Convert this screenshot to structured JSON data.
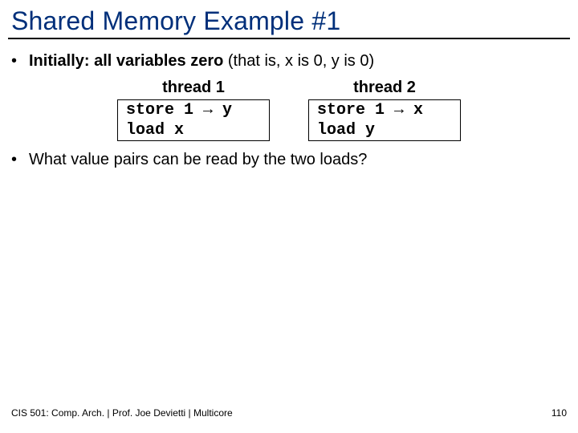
{
  "title": "Shared Memory Example #1",
  "bullets": {
    "b1_bold": "Initially: all variables zero",
    "b1_rest": " (that is, x is 0, y is 0)",
    "b2": "What value pairs can be read by the two loads?"
  },
  "threads": {
    "t1": {
      "title": "thread 1",
      "line1": "store 1 → y",
      "line2": "load x"
    },
    "t2": {
      "title": "thread 2",
      "line1": "store 1 → x",
      "line2": "load y"
    }
  },
  "footer": {
    "left": "CIS 501: Comp. Arch.  |  Prof. Joe Devietti  |  Multicore",
    "right": "110"
  }
}
